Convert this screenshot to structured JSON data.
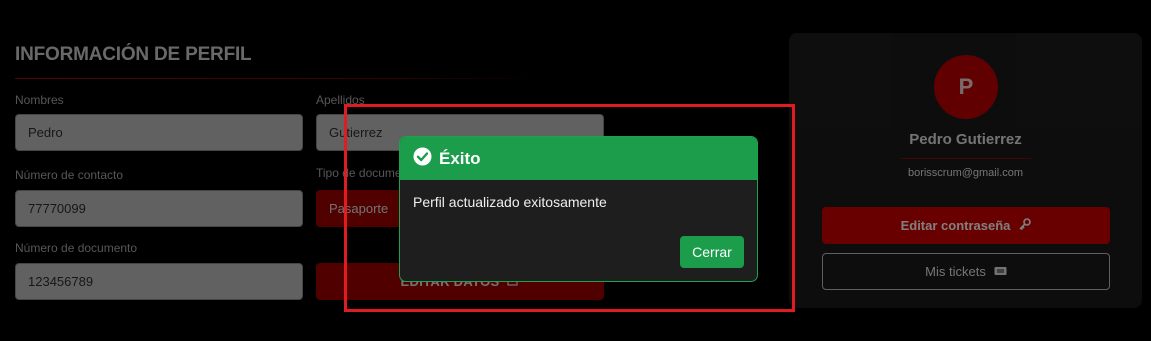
{
  "profile_form": {
    "title": "INFORMACIÓN DE PERFIL",
    "first_name_label": "Nombres",
    "first_name_value": "Pedro",
    "last_name_label": "Apellidos",
    "last_name_value": "Gutierrez",
    "contact_label": "Número de contacto",
    "contact_value": "77770099",
    "doc_type_label": "Tipo de documento",
    "doc_type_value": "Pasaporte",
    "doc_number_label": "Número de documento",
    "doc_number_value": "123456789",
    "edit_button_label": "EDITAR DATOS"
  },
  "profile_card": {
    "avatar_initial": "P",
    "name": "Pedro Gutierrez",
    "email": "borisscrum@gmail.com",
    "edit_password_label": "Editar contraseña",
    "my_tickets_label": "Mis tickets"
  },
  "modal": {
    "title": "Éxito",
    "message": "Perfil actualizado exitosamente",
    "close_label": "Cerrar"
  },
  "colors": {
    "success": "#1b9d4b",
    "brand_red": "#b30000",
    "annotation": "#e11b22"
  }
}
